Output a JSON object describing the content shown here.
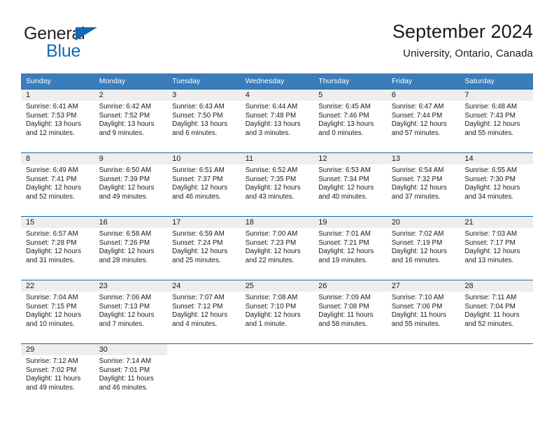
{
  "brand": {
    "name_part1": "General",
    "name_part2": "Blue",
    "accent_color": "#1268b3"
  },
  "header": {
    "title": "September 2024",
    "subtitle": "University, Ontario, Canada"
  },
  "theme": {
    "header_bg": "#3b7cba",
    "row_divider": "#1268b3",
    "daynum_band": "#eeeeee"
  },
  "weekday_headers": [
    "Sunday",
    "Monday",
    "Tuesday",
    "Wednesday",
    "Thursday",
    "Friday",
    "Saturday"
  ],
  "weeks": [
    [
      {
        "day": "1",
        "sunrise": "Sunrise: 6:41 AM",
        "sunset": "Sunset: 7:53 PM",
        "daylight_line1": "Daylight: 13 hours",
        "daylight_line2": "and 12 minutes."
      },
      {
        "day": "2",
        "sunrise": "Sunrise: 6:42 AM",
        "sunset": "Sunset: 7:52 PM",
        "daylight_line1": "Daylight: 13 hours",
        "daylight_line2": "and 9 minutes."
      },
      {
        "day": "3",
        "sunrise": "Sunrise: 6:43 AM",
        "sunset": "Sunset: 7:50 PM",
        "daylight_line1": "Daylight: 13 hours",
        "daylight_line2": "and 6 minutes."
      },
      {
        "day": "4",
        "sunrise": "Sunrise: 6:44 AM",
        "sunset": "Sunset: 7:48 PM",
        "daylight_line1": "Daylight: 13 hours",
        "daylight_line2": "and 3 minutes."
      },
      {
        "day": "5",
        "sunrise": "Sunrise: 6:45 AM",
        "sunset": "Sunset: 7:46 PM",
        "daylight_line1": "Daylight: 13 hours",
        "daylight_line2": "and 0 minutes."
      },
      {
        "day": "6",
        "sunrise": "Sunrise: 6:47 AM",
        "sunset": "Sunset: 7:44 PM",
        "daylight_line1": "Daylight: 12 hours",
        "daylight_line2": "and 57 minutes."
      },
      {
        "day": "7",
        "sunrise": "Sunrise: 6:48 AM",
        "sunset": "Sunset: 7:43 PM",
        "daylight_line1": "Daylight: 12 hours",
        "daylight_line2": "and 55 minutes."
      }
    ],
    [
      {
        "day": "8",
        "sunrise": "Sunrise: 6:49 AM",
        "sunset": "Sunset: 7:41 PM",
        "daylight_line1": "Daylight: 12 hours",
        "daylight_line2": "and 52 minutes."
      },
      {
        "day": "9",
        "sunrise": "Sunrise: 6:50 AM",
        "sunset": "Sunset: 7:39 PM",
        "daylight_line1": "Daylight: 12 hours",
        "daylight_line2": "and 49 minutes."
      },
      {
        "day": "10",
        "sunrise": "Sunrise: 6:51 AM",
        "sunset": "Sunset: 7:37 PM",
        "daylight_line1": "Daylight: 12 hours",
        "daylight_line2": "and 46 minutes."
      },
      {
        "day": "11",
        "sunrise": "Sunrise: 6:52 AM",
        "sunset": "Sunset: 7:35 PM",
        "daylight_line1": "Daylight: 12 hours",
        "daylight_line2": "and 43 minutes."
      },
      {
        "day": "12",
        "sunrise": "Sunrise: 6:53 AM",
        "sunset": "Sunset: 7:34 PM",
        "daylight_line1": "Daylight: 12 hours",
        "daylight_line2": "and 40 minutes."
      },
      {
        "day": "13",
        "sunrise": "Sunrise: 6:54 AM",
        "sunset": "Sunset: 7:32 PM",
        "daylight_line1": "Daylight: 12 hours",
        "daylight_line2": "and 37 minutes."
      },
      {
        "day": "14",
        "sunrise": "Sunrise: 6:55 AM",
        "sunset": "Sunset: 7:30 PM",
        "daylight_line1": "Daylight: 12 hours",
        "daylight_line2": "and 34 minutes."
      }
    ],
    [
      {
        "day": "15",
        "sunrise": "Sunrise: 6:57 AM",
        "sunset": "Sunset: 7:28 PM",
        "daylight_line1": "Daylight: 12 hours",
        "daylight_line2": "and 31 minutes."
      },
      {
        "day": "16",
        "sunrise": "Sunrise: 6:58 AM",
        "sunset": "Sunset: 7:26 PM",
        "daylight_line1": "Daylight: 12 hours",
        "daylight_line2": "and 28 minutes."
      },
      {
        "day": "17",
        "sunrise": "Sunrise: 6:59 AM",
        "sunset": "Sunset: 7:24 PM",
        "daylight_line1": "Daylight: 12 hours",
        "daylight_line2": "and 25 minutes."
      },
      {
        "day": "18",
        "sunrise": "Sunrise: 7:00 AM",
        "sunset": "Sunset: 7:23 PM",
        "daylight_line1": "Daylight: 12 hours",
        "daylight_line2": "and 22 minutes."
      },
      {
        "day": "19",
        "sunrise": "Sunrise: 7:01 AM",
        "sunset": "Sunset: 7:21 PM",
        "daylight_line1": "Daylight: 12 hours",
        "daylight_line2": "and 19 minutes."
      },
      {
        "day": "20",
        "sunrise": "Sunrise: 7:02 AM",
        "sunset": "Sunset: 7:19 PM",
        "daylight_line1": "Daylight: 12 hours",
        "daylight_line2": "and 16 minutes."
      },
      {
        "day": "21",
        "sunrise": "Sunrise: 7:03 AM",
        "sunset": "Sunset: 7:17 PM",
        "daylight_line1": "Daylight: 12 hours",
        "daylight_line2": "and 13 minutes."
      }
    ],
    [
      {
        "day": "22",
        "sunrise": "Sunrise: 7:04 AM",
        "sunset": "Sunset: 7:15 PM",
        "daylight_line1": "Daylight: 12 hours",
        "daylight_line2": "and 10 minutes."
      },
      {
        "day": "23",
        "sunrise": "Sunrise: 7:06 AM",
        "sunset": "Sunset: 7:13 PM",
        "daylight_line1": "Daylight: 12 hours",
        "daylight_line2": "and 7 minutes."
      },
      {
        "day": "24",
        "sunrise": "Sunrise: 7:07 AM",
        "sunset": "Sunset: 7:12 PM",
        "daylight_line1": "Daylight: 12 hours",
        "daylight_line2": "and 4 minutes."
      },
      {
        "day": "25",
        "sunrise": "Sunrise: 7:08 AM",
        "sunset": "Sunset: 7:10 PM",
        "daylight_line1": "Daylight: 12 hours",
        "daylight_line2": "and 1 minute."
      },
      {
        "day": "26",
        "sunrise": "Sunrise: 7:09 AM",
        "sunset": "Sunset: 7:08 PM",
        "daylight_line1": "Daylight: 11 hours",
        "daylight_line2": "and 58 minutes."
      },
      {
        "day": "27",
        "sunrise": "Sunrise: 7:10 AM",
        "sunset": "Sunset: 7:06 PM",
        "daylight_line1": "Daylight: 11 hours",
        "daylight_line2": "and 55 minutes."
      },
      {
        "day": "28",
        "sunrise": "Sunrise: 7:11 AM",
        "sunset": "Sunset: 7:04 PM",
        "daylight_line1": "Daylight: 11 hours",
        "daylight_line2": "and 52 minutes."
      }
    ],
    [
      {
        "day": "29",
        "sunrise": "Sunrise: 7:12 AM",
        "sunset": "Sunset: 7:02 PM",
        "daylight_line1": "Daylight: 11 hours",
        "daylight_line2": "and 49 minutes."
      },
      {
        "day": "30",
        "sunrise": "Sunrise: 7:14 AM",
        "sunset": "Sunset: 7:01 PM",
        "daylight_line1": "Daylight: 11 hours",
        "daylight_line2": "and 46 minutes."
      },
      {
        "day": "",
        "sunrise": "",
        "sunset": "",
        "daylight_line1": "",
        "daylight_line2": ""
      },
      {
        "day": "",
        "sunrise": "",
        "sunset": "",
        "daylight_line1": "",
        "daylight_line2": ""
      },
      {
        "day": "",
        "sunrise": "",
        "sunset": "",
        "daylight_line1": "",
        "daylight_line2": ""
      },
      {
        "day": "",
        "sunrise": "",
        "sunset": "",
        "daylight_line1": "",
        "daylight_line2": ""
      },
      {
        "day": "",
        "sunrise": "",
        "sunset": "",
        "daylight_line1": "",
        "daylight_line2": ""
      }
    ]
  ]
}
